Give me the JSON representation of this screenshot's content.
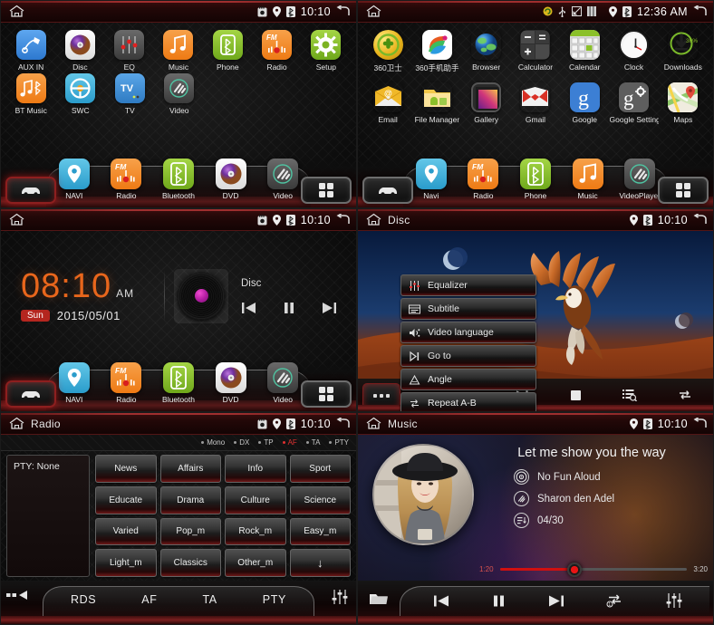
{
  "panels": {
    "home": {
      "statusbar": {
        "title": "",
        "time": "10:10",
        "icons": [
          "sd-card-icon",
          "location-pin-icon",
          "bluetooth-icon"
        ]
      },
      "apps_row1": [
        {
          "label": "AUX IN",
          "icon": "aux-plug-icon",
          "color": "#4b96e8"
        },
        {
          "label": "Disc",
          "icon": "disc-icon",
          "color": "#f2f2f2"
        },
        {
          "label": "EQ",
          "icon": "equalizer-icon",
          "color": "#4a4a4a"
        },
        {
          "label": "Music",
          "icon": "music-note-icon",
          "color": "#f08a28"
        },
        {
          "label": "Phone",
          "icon": "bluetooth-phone-icon",
          "color": "#8bc02a"
        },
        {
          "label": "Radio",
          "icon": "fm-radio-icon",
          "color": "#f08a28"
        },
        {
          "label": "Setup",
          "icon": "gear-icon",
          "color": "#8bc02a"
        }
      ],
      "apps_row2": [
        {
          "label": "BT Music",
          "icon": "bt-music-icon",
          "color": "#f08a28"
        },
        {
          "label": "SWC",
          "icon": "steering-wheel-icon",
          "color": "#4bb6e0"
        },
        {
          "label": "TV",
          "icon": "tv-icon",
          "color": "#3e8fd6"
        },
        {
          "label": "Video",
          "icon": "video-player-icon",
          "color": "#4a4a4a"
        }
      ],
      "dock": [
        {
          "label": "NAVI",
          "icon": "navi-pin-icon",
          "color": "#4bb6e0"
        },
        {
          "label": "Radio",
          "icon": "fm-radio-icon",
          "color": "#f08a28"
        },
        {
          "label": "Bluetooth",
          "icon": "bluetooth-icon",
          "color": "#8bc02a"
        },
        {
          "label": "DVD",
          "icon": "disc-icon",
          "color": "#f2f2f2"
        },
        {
          "label": "Video",
          "icon": "video-player-icon",
          "color": "#4a4a4a"
        }
      ],
      "corner_left": "car-icon",
      "corner_right": "apps-grid-icon"
    },
    "drawer": {
      "statusbar": {
        "time": "12:36 AM",
        "icons": [
          "sync-icon",
          "usb-icon",
          "screenshot-icon",
          "sim-icon",
          "location-pin-icon",
          "bluetooth-icon"
        ]
      },
      "apps_row1": [
        {
          "label": "360卫士",
          "icon": "360-guard-icon"
        },
        {
          "label": "360手机助手",
          "icon": "360-assistant-icon"
        },
        {
          "label": "Browser",
          "icon": "browser-globe-icon"
        },
        {
          "label": "Calculator",
          "icon": "calculator-icon"
        },
        {
          "label": "Calendar",
          "icon": "calendar-icon"
        },
        {
          "label": "Clock",
          "icon": "clock-icon"
        },
        {
          "label": "Downloads",
          "icon": "downloads-icon",
          "badge": "36%"
        }
      ],
      "apps_row2": [
        {
          "label": "Email",
          "icon": "email-icon"
        },
        {
          "label": "File Manager",
          "icon": "file-manager-icon"
        },
        {
          "label": "Gallery",
          "icon": "gallery-icon"
        },
        {
          "label": "Gmail",
          "icon": "gmail-icon"
        },
        {
          "label": "Google",
          "icon": "google-icon"
        },
        {
          "label": "Google Settings",
          "icon": "google-settings-icon"
        },
        {
          "label": "Maps",
          "icon": "maps-icon"
        }
      ],
      "dock": [
        {
          "label": "Navi",
          "icon": "navi-pin-icon",
          "color": "#4bb6e0"
        },
        {
          "label": "Radio",
          "icon": "fm-radio-icon",
          "color": "#f08a28"
        },
        {
          "label": "Phone",
          "icon": "bluetooth-phone-icon",
          "color": "#8bc02a"
        },
        {
          "label": "Music",
          "icon": "music-note-icon",
          "color": "#f08a28"
        },
        {
          "label": "VideoPlayer",
          "icon": "video-player-icon",
          "color": "#4a4a4a"
        }
      ],
      "corner_left": "car-icon",
      "corner_right": "apps-grid-icon"
    },
    "clock": {
      "statusbar": {
        "time": "10:10"
      },
      "time": "08:10",
      "ampm": "AM",
      "day": "Sun",
      "date": "2015/05/01",
      "media_source": "Disc",
      "media_buttons": [
        "prev-track-button",
        "pause-button",
        "next-track-button"
      ],
      "dock": [
        {
          "label": "NAVI",
          "icon": "navi-pin-icon",
          "color": "#4bb6e0"
        },
        {
          "label": "Radio",
          "icon": "fm-radio-icon",
          "color": "#f08a28"
        },
        {
          "label": "Bluetooth",
          "icon": "bluetooth-icon",
          "color": "#8bc02a"
        },
        {
          "label": "DVD",
          "icon": "disc-icon",
          "color": "#f2f2f2"
        },
        {
          "label": "Video",
          "icon": "video-player-icon",
          "color": "#4a4a4a"
        }
      ]
    },
    "disc": {
      "statusbar": {
        "title": "Disc",
        "time": "10:10"
      },
      "menu": [
        {
          "label": "Equalizer",
          "icon": "equalizer-icon"
        },
        {
          "label": "Subtitle",
          "icon": "subtitle-icon"
        },
        {
          "label": "Video language",
          "icon": "audio-language-icon"
        },
        {
          "label": "Go to",
          "icon": "goto-icon"
        },
        {
          "label": "Angle",
          "icon": "angle-icon"
        },
        {
          "label": "Repeat A-B",
          "icon": "repeat-ab-icon"
        }
      ],
      "controls": [
        "more-button",
        "next-track-button",
        "stop-button",
        "playlist-search-button",
        "repeat-button"
      ]
    },
    "radio": {
      "statusbar": {
        "title": "Radio",
        "time": "10:10"
      },
      "indicators": [
        {
          "label": "Mono",
          "active": false
        },
        {
          "label": "DX",
          "active": false
        },
        {
          "label": "TP",
          "active": false
        },
        {
          "label": "AF",
          "active": true
        },
        {
          "label": "TA",
          "active": false
        },
        {
          "label": "PTY",
          "active": false
        }
      ],
      "pty_label": "PTY:  None",
      "pty_buttons": [
        "News",
        "Affairs",
        "Info",
        "Sport",
        "Educate",
        "Drama",
        "Culture",
        "Science",
        "Varied",
        "Pop_m",
        "Rock_m",
        "Easy_m",
        "Light_m",
        "Classics",
        "Other_m",
        "↓"
      ],
      "tabs": [
        "RDS",
        "AF",
        "TA",
        "PTY"
      ],
      "left_button": "band-list-icon",
      "right_button": "equalizer-icon"
    },
    "music": {
      "statusbar": {
        "title": "Music",
        "time": "10:10"
      },
      "song_title": "Let me show you the way",
      "album": "No Fun Aloud",
      "artist": "Sharon den Adel",
      "track_index": "04/30",
      "elapsed": "1:20",
      "duration": "3:20",
      "progress_percent": 40,
      "controls": [
        "folder-button",
        "prev-track-button",
        "pause-button",
        "next-track-button",
        "repeat-one-button",
        "equalizer-button"
      ]
    }
  },
  "colors": {
    "accent_red": "#b4261f",
    "accent_orange": "#e8661c",
    "active_red": "#e03030",
    "progress_red": "#d01010"
  }
}
